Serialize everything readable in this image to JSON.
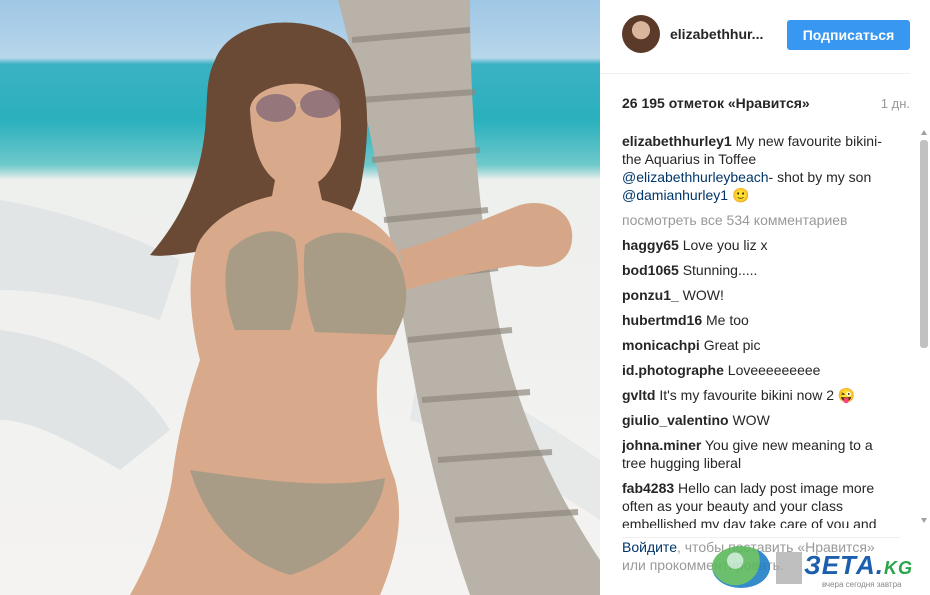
{
  "header": {
    "username": "elizabethhur...",
    "follow_label": "Подписаться"
  },
  "stats": {
    "likes": "26 195 отметок «Нравится»",
    "time": "1 дн."
  },
  "caption": {
    "user": "elizabethhurley1",
    "text_a": "My new favourite bikini- the Aquarius in Toffee",
    "mention_1": "@elizabethhurleybeach",
    "text_b": "- shot by my son",
    "mention_2": "@damianhurley1",
    "emoji": "🙂"
  },
  "view_all": "посмотреть все 534 комментариев",
  "comments": [
    {
      "user": "haggy65",
      "text": "Love you liz x"
    },
    {
      "user": "bod1065",
      "text": "Stunning....."
    },
    {
      "user": "ponzu1_",
      "text": "WOW!"
    },
    {
      "user": "hubertmd16",
      "text": "Me too"
    },
    {
      "user": "monicachpi",
      "text": "Great pic"
    },
    {
      "user": "id.photographe",
      "text": "Loveeeeeeeee"
    },
    {
      "user": "gvltd",
      "text": "It's my favourite bikini now 2 😜"
    },
    {
      "user": "giulio_valentino",
      "text": "WOW"
    },
    {
      "user": "johna.miner",
      "text": "You give new meaning to a tree hugging liberal"
    },
    {
      "user": "fab4283",
      "text": "Hello can lady post image more often as your beauty and your class embellished my day take care of you and"
    }
  ],
  "login_note": {
    "link": "Войдите",
    "text": ", чтобы поставить «Нравится» или прокомментировать."
  },
  "watermark": {
    "brand": "ЗЕТА.",
    "suffix": "KG",
    "tagline": "вчера сегодня завтра"
  },
  "colors": {
    "follow_button": "#3897f0",
    "link": "#003569",
    "muted": "#999999"
  }
}
